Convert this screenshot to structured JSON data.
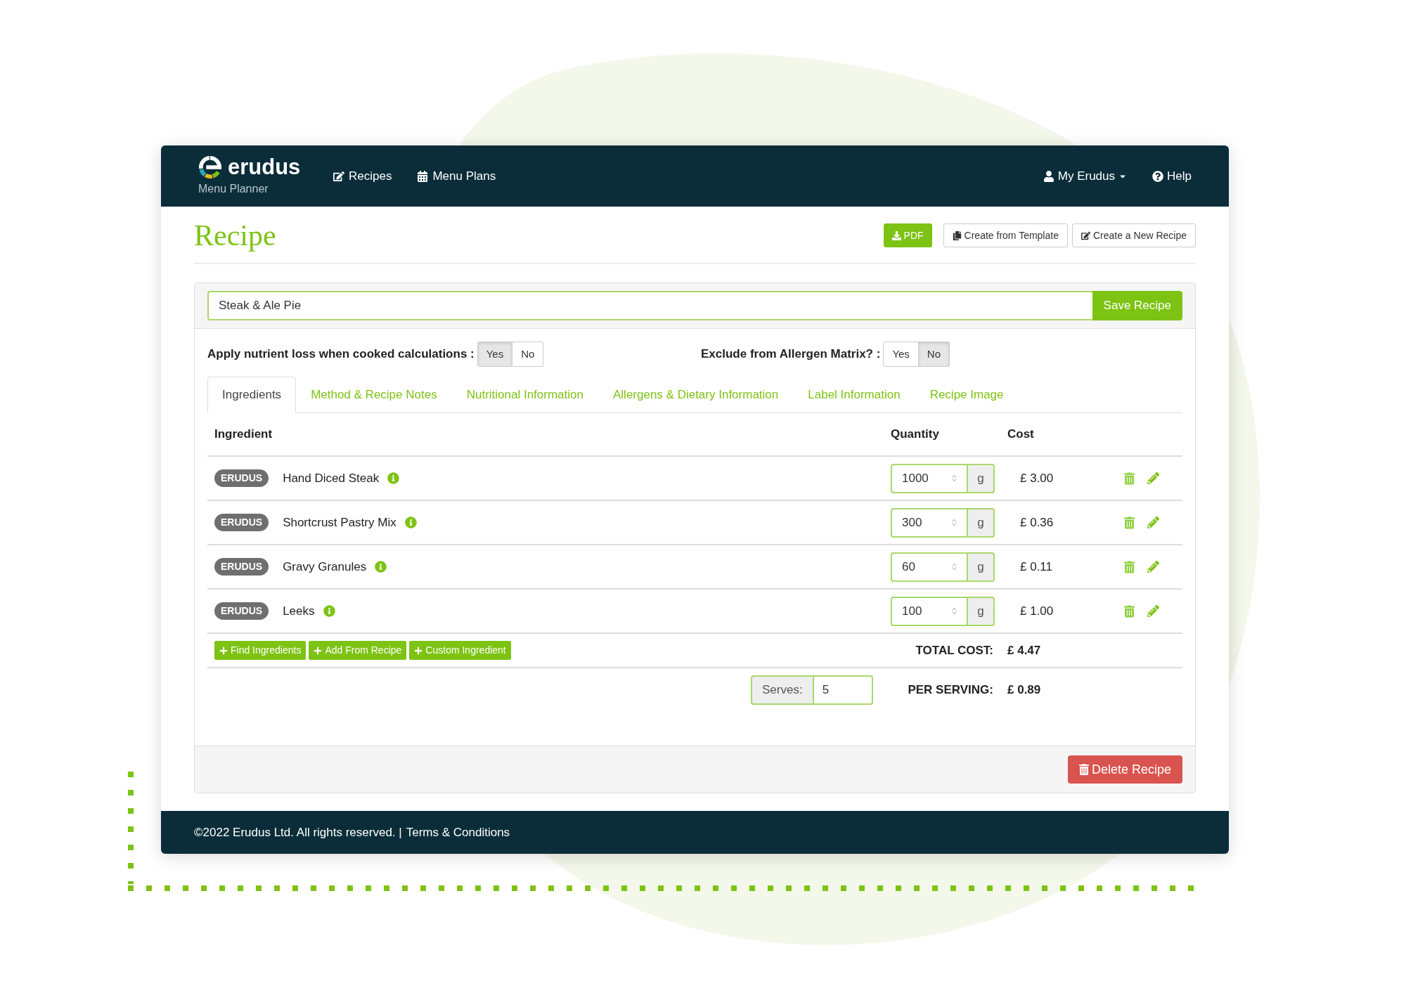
{
  "header": {
    "logo": "erudus",
    "subtitle": "Menu Planner",
    "nav": [
      {
        "label": "Recipes"
      },
      {
        "label": "Menu Plans"
      }
    ],
    "user_menu": "My Erudus",
    "help": "Help"
  },
  "page": {
    "title": "Recipe",
    "actions": [
      {
        "kind": "primary",
        "label": "PDF"
      },
      {
        "kind": "default",
        "label": "Create from Template"
      },
      {
        "kind": "default",
        "label": "Create a New Recipe"
      }
    ]
  },
  "recipe_name": {
    "value": "Steak & Ale Pie",
    "save": "Save Recipe"
  },
  "toggles": [
    {
      "label": "Apply nutrient loss when cooked calculations :",
      "options": [
        {
          "label": "Yes",
          "selected": true
        },
        {
          "label": "No",
          "selected": false
        }
      ]
    },
    {
      "label": "Exclude from Allergen Matrix? :",
      "options": [
        {
          "label": "Yes",
          "selected": false
        },
        {
          "label": "No",
          "selected": true
        }
      ]
    }
  ],
  "tabs": [
    {
      "label": "Ingredients",
      "selected": true
    },
    {
      "label": "Method & Recipe Notes",
      "selected": false
    },
    {
      "label": "Nutritional Information",
      "selected": false
    },
    {
      "label": "Allergens & Dietary Information",
      "selected": false
    },
    {
      "label": "Label Information",
      "selected": false
    },
    {
      "label": "Recipe Image",
      "selected": false
    }
  ],
  "table": {
    "columns": [
      "Ingredient",
      "Quantity",
      "Cost"
    ],
    "rows": [
      {
        "badge": "ERUDUS",
        "name": "Hand Diced Steak",
        "quantity": "1000",
        "unit": "g",
        "cost": "£ 3.00"
      },
      {
        "badge": "ERUDUS",
        "name": "Shortcrust Pastry Mix",
        "quantity": "300",
        "unit": "g",
        "cost": "£ 0.36"
      },
      {
        "badge": "ERUDUS",
        "name": "Gravy Granules",
        "quantity": "60",
        "unit": "g",
        "cost": "£ 0.11"
      },
      {
        "badge": "ERUDUS",
        "name": "Leeks",
        "quantity": "100",
        "unit": "g",
        "cost": "£ 1.00"
      }
    ]
  },
  "add_buttons": [
    "Find Ingredients",
    "Add From Recipe",
    "Custom Ingredient"
  ],
  "total": {
    "label": "TOTAL COST:",
    "value": "£ 4.47"
  },
  "serves": {
    "label": "Serves:",
    "value": "5"
  },
  "per_serving": {
    "label": "PER SERVING:",
    "value": "£ 0.89"
  },
  "delete": "Delete Recipe",
  "footer": {
    "copyright": "©2022 Erudus Ltd. All rights reserved. |",
    "link": "Terms & Conditions"
  }
}
